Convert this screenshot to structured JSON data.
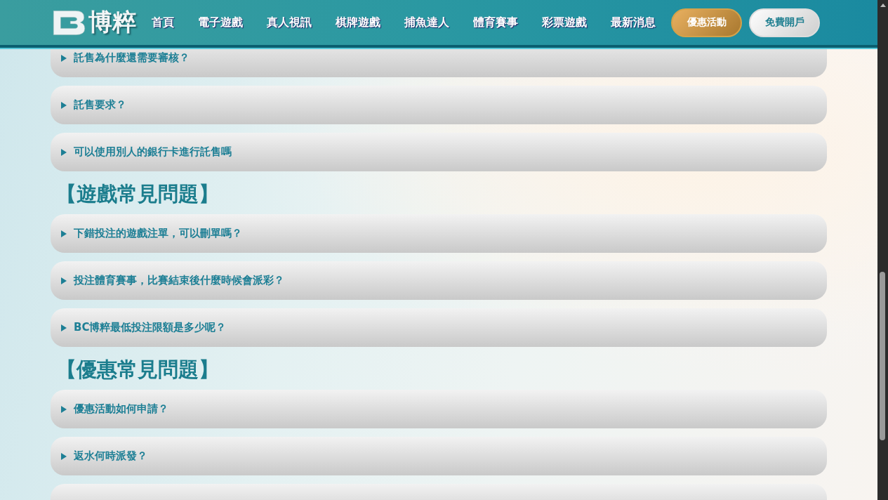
{
  "header": {
    "logo_text": "博粹",
    "nav": [
      {
        "label": "首頁"
      },
      {
        "label": "電子遊戲"
      },
      {
        "label": "真人視訊"
      },
      {
        "label": "棋牌遊戲"
      },
      {
        "label": "捕魚達人"
      },
      {
        "label": "體育賽事"
      },
      {
        "label": "彩票遊戲"
      },
      {
        "label": "最新消息"
      }
    ],
    "buttons": [
      {
        "label": "優惠活動",
        "kind": "gold"
      },
      {
        "label": "免費開戶",
        "kind": "silver"
      }
    ]
  },
  "sections": [
    {
      "items": [
        {
          "kind": "faq",
          "question": "託售為什麼還需要審核？"
        },
        {
          "kind": "faq",
          "question": "託售要求？"
        },
        {
          "kind": "faq",
          "question": "可以使用別人的銀行卡進行託售嗎"
        }
      ]
    },
    {
      "heading": "【遊戲常見問題】",
      "items": [
        {
          "kind": "faq",
          "question": "下錯投注的遊戲注單，可以刪單嗎？"
        },
        {
          "kind": "faq",
          "question": "投注體育賽事，比賽結束後什麼時候會派彩？"
        },
        {
          "kind": "faq",
          "question": "BC博粹最低投注限額是多少呢？"
        }
      ]
    },
    {
      "heading": "【優惠常見問題】",
      "items": [
        {
          "kind": "faq",
          "question": "優惠活動如何申請？"
        },
        {
          "kind": "faq",
          "question": "返水何時派發？"
        },
        {
          "kind": "cut"
        }
      ]
    }
  ]
}
